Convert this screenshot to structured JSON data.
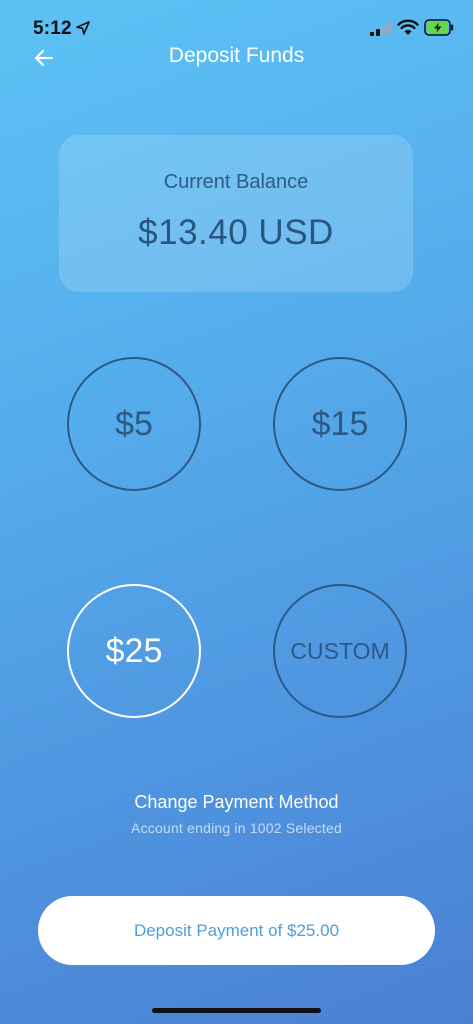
{
  "status_bar": {
    "time": "5:12"
  },
  "header": {
    "title": "Deposit Funds",
    "back_icon": "arrow-left-icon"
  },
  "balance": {
    "label": "Current Balance",
    "amount": "$13.40 USD"
  },
  "amount_options": [
    {
      "label": "$5",
      "selected": false
    },
    {
      "label": "$15",
      "selected": false
    },
    {
      "label": "$25",
      "selected": true
    },
    {
      "label": "CUSTOM",
      "selected": false
    }
  ],
  "payment": {
    "title": "Change Payment Method",
    "subtitle": "Account ending in 1002 Selected"
  },
  "deposit_button": {
    "label": "Deposit Payment of $25.00"
  },
  "colors": {
    "background_top": "#5cc2f5",
    "background_bottom": "#4b7fd3",
    "ring": "#2d5983",
    "ring_selected": "#ffffff",
    "button_text": "#4ea0d8"
  }
}
